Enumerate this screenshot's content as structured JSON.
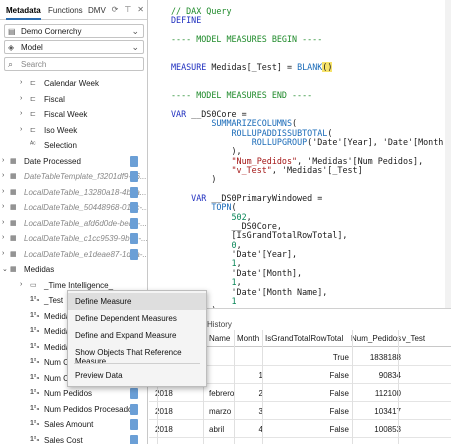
{
  "left_panel": {
    "tabs": [
      "Metadata",
      "Functions",
      "DMV"
    ],
    "tab_icons": [
      "refresh-icon",
      "pin-icon",
      "close-icon"
    ],
    "connection": "Demo Cornerchy",
    "model": "Model",
    "search_placeholder": "Search",
    "tree": [
      {
        "label": "Calendar Week",
        "kind": "hierarchy"
      },
      {
        "label": "Fiscal",
        "kind": "hierarchy"
      },
      {
        "label": "Fiscal Week",
        "kind": "hierarchy"
      },
      {
        "label": "Iso Week",
        "kind": "hierarchy"
      },
      {
        "label": "Selection",
        "kind": "text"
      },
      {
        "label": "Date Processed",
        "kind": "table"
      },
      {
        "label": "DateTableTemplate_f3201df9-66...",
        "kind": "hidden"
      },
      {
        "label": "LocalDateTable_13280a18-4b2a...",
        "kind": "hidden"
      },
      {
        "label": "LocalDateTable_50448968-010c-...",
        "kind": "hidden"
      },
      {
        "label": "LocalDateTable_afd6d0de-bead-...",
        "kind": "hidden"
      },
      {
        "label": "LocalDateTable_c1cc9539-9b6e-...",
        "kind": "hidden"
      },
      {
        "label": "LocalDateTable_e1deae87-1daa-...",
        "kind": "hidden"
      },
      {
        "label": "Medidas",
        "kind": "table"
      },
      {
        "label": "_Time Intelligence_",
        "kind": "folder"
      },
      {
        "label": "_Test",
        "kind": "measure"
      },
      {
        "label": "Medida",
        "kind": "measure"
      },
      {
        "label": "Medida",
        "kind": "measure"
      },
      {
        "label": "Medida",
        "kind": "measure"
      },
      {
        "label": "Num Cl",
        "kind": "measure"
      },
      {
        "label": "Num Cl",
        "kind": "measure"
      },
      {
        "label": "Num Pedidos",
        "kind": "measure"
      },
      {
        "label": "Num Pedidos Procesados",
        "kind": "measure"
      },
      {
        "label": "Sales Amount",
        "kind": "measure"
      },
      {
        "label": "Sales Cost",
        "kind": "measure"
      }
    ]
  },
  "context_menu": {
    "items": [
      "Define Measure",
      "Define Dependent Measures",
      "Define and Expand Measure",
      "Show Objects That Reference Measure",
      "Preview Data"
    ]
  },
  "editor": {
    "lines": [
      {
        "n": "1",
        "segs": [
          [
            "cm",
            "// DAX Query"
          ]
        ]
      },
      {
        "n": "2",
        "segs": [
          [
            "kw",
            "DEFINE"
          ]
        ]
      },
      {
        "n": "3",
        "segs": [
          [
            "tx",
            ""
          ]
        ]
      },
      {
        "n": "4",
        "segs": [
          [
            "cm",
            "---- MODEL MEASURES BEGIN ----"
          ]
        ]
      },
      {
        "n": "5",
        "segs": [
          [
            "tx",
            ""
          ]
        ]
      },
      {
        "n": "6",
        "segs": [
          [
            "tx",
            ""
          ]
        ]
      },
      {
        "n": "7",
        "segs": [
          [
            "kw",
            "MEASURE "
          ],
          [
            "tx",
            "Medidas[_Test] = "
          ],
          [
            "fn",
            "BLANK"
          ],
          [
            "hl",
            "()"
          ]
        ]
      },
      {
        "n": "8",
        "segs": [
          [
            "tx",
            ""
          ]
        ]
      },
      {
        "n": "9",
        "segs": [
          [
            "tx",
            ""
          ]
        ]
      },
      {
        "n": "10",
        "segs": [
          [
            "cm",
            "---- MODEL MEASURES END ----"
          ]
        ]
      },
      {
        "n": "11",
        "segs": [
          [
            "tx",
            ""
          ]
        ]
      },
      {
        "n": "12",
        "segs": [
          [
            "kw",
            "VAR "
          ],
          [
            "tx",
            "__DS0Core ="
          ]
        ]
      },
      {
        "n": "13",
        "segs": [
          [
            "tx",
            "        "
          ],
          [
            "fn",
            "SUMMARIZECOLUMNS"
          ],
          [
            "tx",
            "("
          ]
        ]
      },
      {
        "n": "14",
        "segs": [
          [
            "tx",
            "            "
          ],
          [
            "fn",
            "ROLLUPADDISSUBTOTAL"
          ],
          [
            "tx",
            "("
          ]
        ]
      },
      {
        "n": "15",
        "segs": [
          [
            "tx",
            "                "
          ],
          [
            "fn",
            "ROLLUPGROUP"
          ],
          [
            "tx",
            "('Date'[Year], 'Date'[Month"
          ]
        ]
      },
      {
        "n": "16",
        "segs": [
          [
            "tx",
            "            ),"
          ]
        ]
      },
      {
        "n": "17",
        "segs": [
          [
            "tx",
            "            "
          ],
          [
            "str",
            "\"Num_Pedidos\""
          ],
          [
            "tx",
            ", 'Medidas'[Num Pedidos],"
          ]
        ]
      },
      {
        "n": "18",
        "segs": [
          [
            "tx",
            "            "
          ],
          [
            "str",
            "\"v_Test\""
          ],
          [
            "tx",
            ", 'Medidas'[_Test]"
          ]
        ]
      },
      {
        "n": "19",
        "segs": [
          [
            "tx",
            "        )"
          ]
        ]
      },
      {
        "n": "20",
        "segs": [
          [
            "tx",
            ""
          ]
        ]
      },
      {
        "n": "21",
        "segs": [
          [
            "tx",
            "    "
          ],
          [
            "kw",
            "VAR "
          ],
          [
            "tx",
            "__DS0PrimaryWindowed ="
          ]
        ]
      },
      {
        "n": "22",
        "segs": [
          [
            "tx",
            "        "
          ],
          [
            "fn",
            "TOPN"
          ],
          [
            "tx",
            "("
          ]
        ]
      },
      {
        "n": "23",
        "segs": [
          [
            "tx",
            "            "
          ],
          [
            "num",
            "502"
          ],
          [
            "tx",
            ","
          ]
        ]
      },
      {
        "n": "24",
        "segs": [
          [
            "tx",
            "            __DS0Core,"
          ]
        ]
      },
      {
        "n": "25",
        "segs": [
          [
            "tx",
            "            [IsGrandTotalRowTotal],"
          ]
        ]
      },
      {
        "n": "26",
        "segs": [
          [
            "tx",
            "            "
          ],
          [
            "num",
            "0"
          ],
          [
            "tx",
            ","
          ]
        ]
      },
      {
        "n": "27",
        "segs": [
          [
            "tx",
            "            'Date'[Year],"
          ]
        ]
      },
      {
        "n": "28",
        "segs": [
          [
            "tx",
            "            "
          ],
          [
            "num",
            "1"
          ],
          [
            "tx",
            ","
          ]
        ]
      },
      {
        "n": "29",
        "segs": [
          [
            "tx",
            "            'Date'[Month],"
          ]
        ]
      },
      {
        "n": "30",
        "segs": [
          [
            "tx",
            "            "
          ],
          [
            "num",
            "1"
          ],
          [
            "tx",
            ","
          ]
        ]
      },
      {
        "n": "31",
        "segs": [
          [
            "tx",
            "            'Date'[Month Name],"
          ]
        ]
      },
      {
        "n": "32",
        "segs": [
          [
            "tx",
            "            "
          ],
          [
            "num",
            "1"
          ]
        ]
      },
      {
        "n": "33",
        "segs": [
          [
            "tx",
            "        )"
          ]
        ]
      }
    ]
  },
  "results": {
    "tab_label": "History",
    "columns": [
      "",
      "Name",
      "Month",
      "IsGrandTotalRowTotal",
      "Num_Pedidos",
      "v_Test"
    ],
    "rows": [
      [
        "",
        "",
        "",
        "True",
        "1838188",
        ""
      ],
      [
        "",
        "",
        "1",
        "False",
        "90834",
        ""
      ],
      [
        "2018",
        "febrero",
        "2",
        "False",
        "112100",
        ""
      ],
      [
        "2018",
        "marzo",
        "3",
        "False",
        "103417",
        ""
      ],
      [
        "2018",
        "abril",
        "4",
        "False",
        "100853",
        ""
      ],
      [
        "2018",
        "mayo",
        "5",
        "False",
        "69875",
        ""
      ]
    ]
  }
}
